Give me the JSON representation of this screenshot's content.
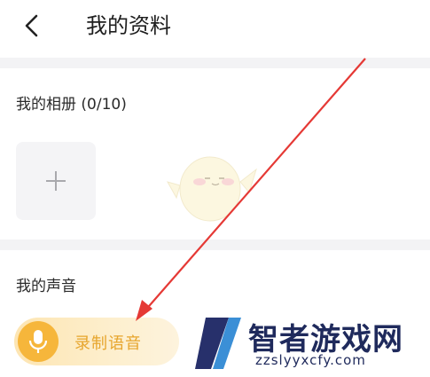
{
  "header": {
    "title": "我的资料",
    "back_icon": "back-chevron-icon"
  },
  "album": {
    "label": "我的相册 (0/10)",
    "add_icon": "plus-icon"
  },
  "voice": {
    "label": "我的声音",
    "record_button": {
      "label": "录制语音",
      "icon": "microphone-icon"
    }
  },
  "watermark": {
    "brand": "智者游戏网",
    "url": "zzslyyxcfy.com"
  },
  "colors": {
    "accent": "#f6b63b",
    "record_text": "#e7a52c",
    "arrow": "#e53935",
    "divider": "#f3f3f5",
    "watermark": "#1f2a5c"
  }
}
